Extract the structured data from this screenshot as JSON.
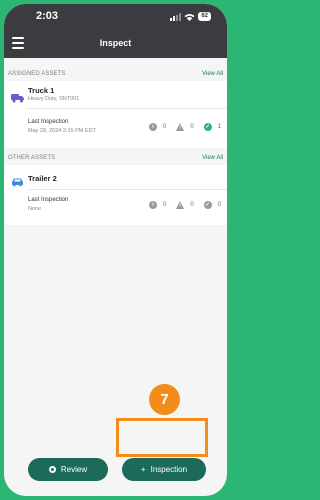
{
  "status": {
    "time": "2:03",
    "battery": "62"
  },
  "header": {
    "title": "Inspect"
  },
  "assigned": {
    "label": "ASSIGNED ASSETS",
    "view_all": "View All",
    "asset": {
      "name": "Truck 1",
      "subtitle": "Heavy Duty, SNT001",
      "last_label": "Last Inspection",
      "last_value": "May 28, 2024 2:15 PM EDT",
      "counts": {
        "info": "0",
        "warning": "0",
        "ok": "1"
      }
    }
  },
  "other": {
    "label": "OTHER ASSETS",
    "view_all": "View All",
    "asset": {
      "name": "Trailer 2",
      "last_label": "Last Inspection",
      "last_value": "None",
      "counts": {
        "info": "0",
        "warning": "0",
        "ok": "0"
      }
    }
  },
  "actions": {
    "review": "Review",
    "inspection": "Inspection",
    "inspection_icon": "+"
  },
  "annotation": {
    "step": "7"
  },
  "colors": {
    "accent": "#1c6b5a",
    "highlight": "#f28c1b",
    "ok": "#2bb673",
    "frame": "#2bb673"
  },
  "icons": [
    "hamburger-icon",
    "truck-icon",
    "car-icon",
    "info-icon",
    "warning-icon",
    "check-icon",
    "record-icon",
    "plus-icon"
  ]
}
